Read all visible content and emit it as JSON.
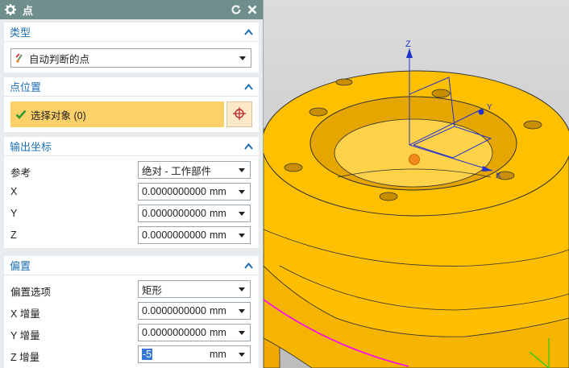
{
  "dialog": {
    "title": "点"
  },
  "sections": {
    "type": {
      "title": "类型",
      "value": "自动判断的点"
    },
    "point_location": {
      "title": "点位置",
      "select_label": "选择对象 (0)"
    },
    "output_coords": {
      "title": "输出坐标",
      "reference_label": "参考",
      "reference_value": "绝对 - 工作部件",
      "x_label": "X",
      "x_value": "0.0000000000",
      "x_unit": "mm",
      "y_label": "Y",
      "y_value": "0.0000000000",
      "y_unit": "mm",
      "z_label": "Z",
      "z_value": "0.0000000000",
      "z_unit": "mm"
    },
    "offset": {
      "title": "偏置",
      "option_label": "偏置选项",
      "option_value": "矩形",
      "xinc_label": "X 增量",
      "xinc_value": "0.0000000000",
      "xinc_unit": "mm",
      "yinc_label": "Y 增量",
      "yinc_value": "0.0000000000",
      "yinc_unit": "mm",
      "zinc_label": "Z 增量",
      "zinc_value": "-5",
      "zinc_unit": "mm"
    }
  },
  "viewport": {
    "axis_labels": {
      "z": "Z",
      "y": "Y",
      "x": "X"
    }
  },
  "colors": {
    "titlebar": "#6f8f8c",
    "section_title": "#1f6fb5",
    "select_bar": "#fcd16a",
    "part": "#ffc000",
    "curve": "#ff00ff"
  }
}
